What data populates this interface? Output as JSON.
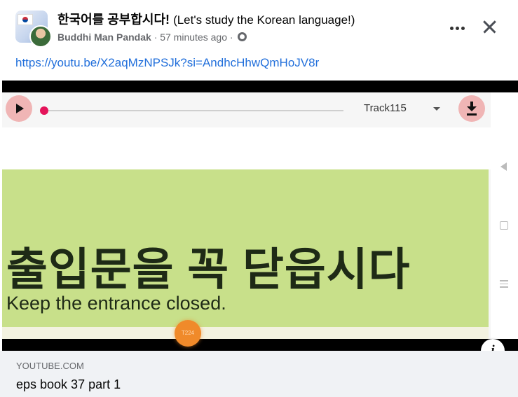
{
  "header": {
    "group_name": "한국어를 공부합시다!",
    "group_subtitle": "(Let's study the Korean language!)",
    "author": "Buddhi Man Pandak",
    "separator": "·",
    "time_ago": "57 minutes ago",
    "privacy_icon": "globe-icon"
  },
  "post": {
    "link_text": "https://youtu.be/X2aqMzNPSJk?si=AndhcHhwQmHoJV8r"
  },
  "video": {
    "track_name": "Track115",
    "korean_caption": "출입문을 꼭 닫읍시다",
    "english_caption": "Keep the entrance closed.",
    "timestamp": "T224",
    "slide_color": "#c8e08a",
    "accent_color": "#e4145a"
  },
  "link_preview": {
    "domain": "YOUTUBE.COM",
    "title": "eps book 37 part 1"
  },
  "icons": {
    "more": "more-options-icon",
    "close": "close-icon",
    "info": "info-icon",
    "play": "play-icon",
    "download": "download-icon"
  },
  "colors": {
    "link": "#216fdb",
    "meta": "#65676b",
    "footer_bg": "#f0f2f5"
  }
}
